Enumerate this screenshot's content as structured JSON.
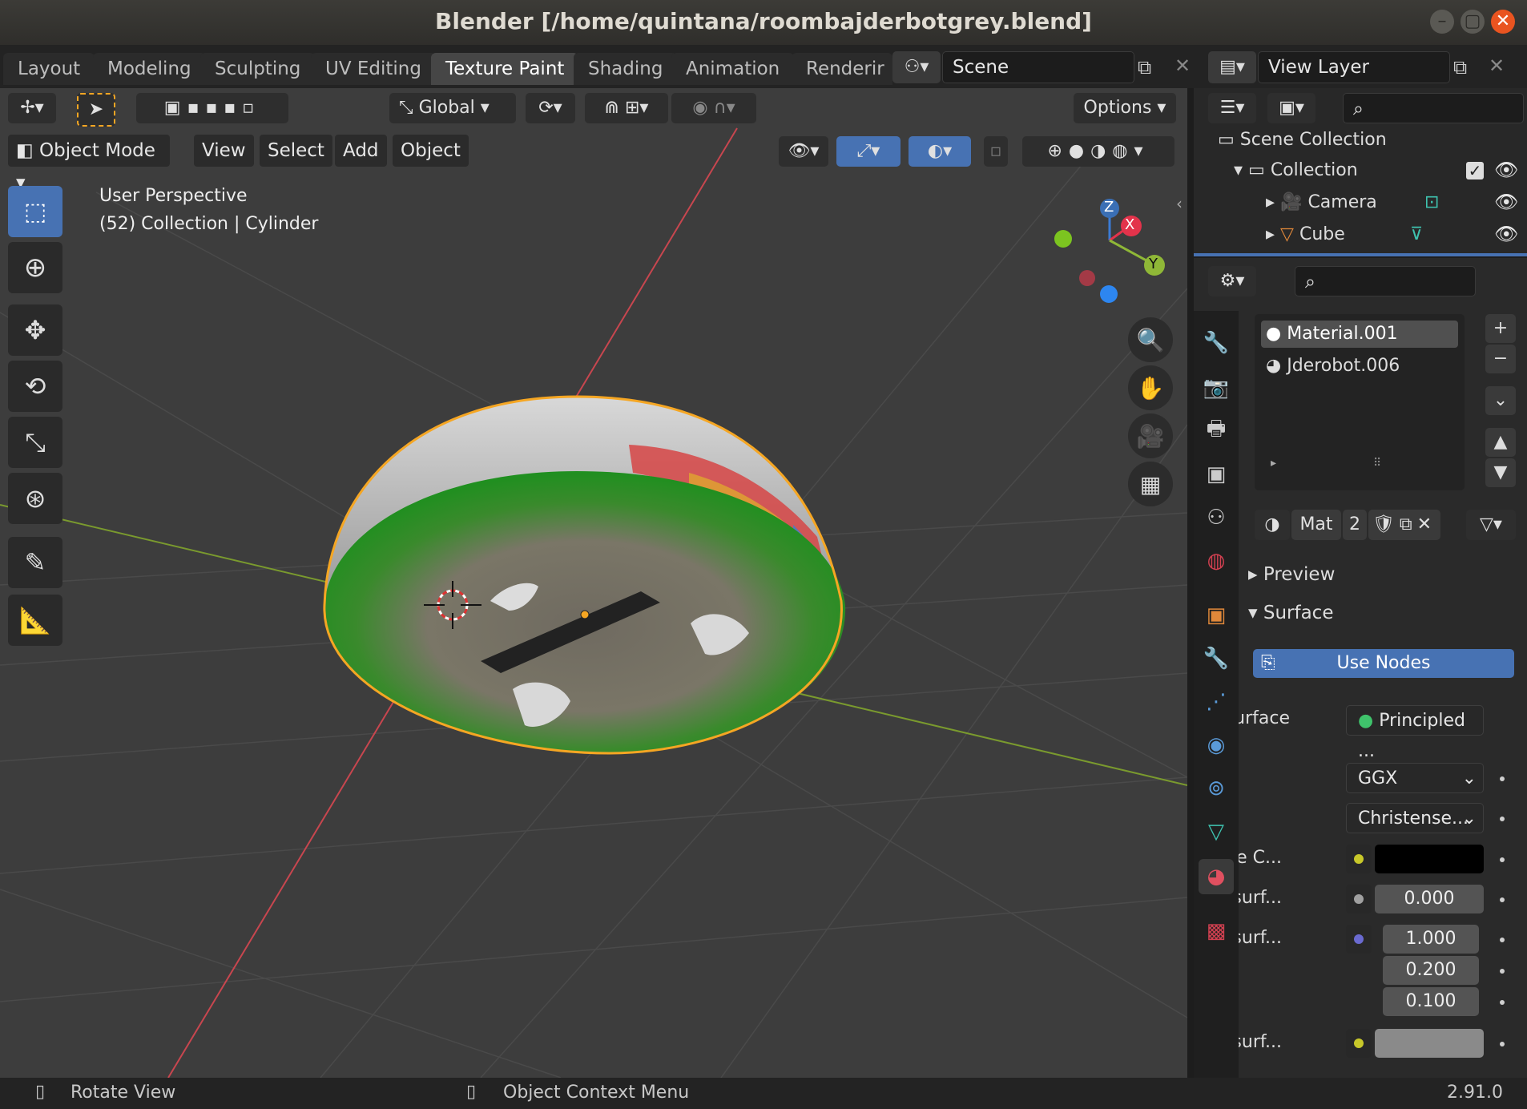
{
  "window": {
    "title": "Blender [/home/quintana/roombajderbotgrey.blend]"
  },
  "workspaces": [
    "Layout",
    "Modeling",
    "Sculpting",
    "UV Editing",
    "Texture Paint",
    "Shading",
    "Animation",
    "Renderir"
  ],
  "active_workspace": "Texture Paint",
  "scene": {
    "name": "Scene"
  },
  "view_layer": {
    "name": "View Layer"
  },
  "viewport": {
    "transform_orientation": "Global",
    "options_label": "Options",
    "mode": "Object Mode",
    "menus": [
      "View",
      "Select",
      "Add",
      "Object"
    ],
    "overlay_line1": "User Perspective",
    "overlay_line2": "(52) Collection | Cylinder",
    "gizmo": {
      "z": "Z",
      "x": "X",
      "y": "Y"
    }
  },
  "outliner": {
    "root": "Scene Collection",
    "collection": "Collection",
    "items": [
      "Camera",
      "Cube"
    ]
  },
  "properties": {
    "materials": [
      "Material.001",
      "Jderobot.006"
    ],
    "material_name": "Mat",
    "users": "2",
    "panels": {
      "preview": "Preview",
      "surface": "Surface"
    },
    "use_nodes": "Use Nodes",
    "surface_label": "Surface",
    "surface_shader": "Principled ...",
    "distribution": "GGX",
    "subsurface_method": "Christense...",
    "base_color_label": "Base C...",
    "subsurface_label": "Subsurf...",
    "subsurface_value": "0.000",
    "subsurface_radius_label": "Subsurf...",
    "subsurface_radius": [
      "1.000",
      "0.200",
      "0.100"
    ],
    "subsurface_color_label": "Subsurf..."
  },
  "status": {
    "left": "Rotate View",
    "middle": "Object Context Menu",
    "version": "2.91.0"
  },
  "colors": {
    "accent": "#4772b3",
    "selection_outline": "#f5a623",
    "x_axis": "#e3334b",
    "y_axis": "#8fb737",
    "z_axis": "#3a7bd5"
  }
}
